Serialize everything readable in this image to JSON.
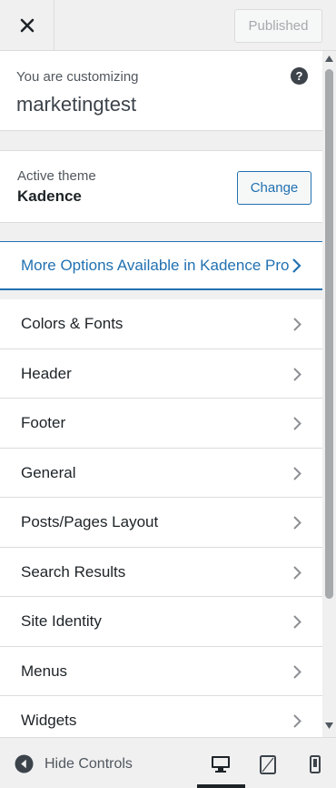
{
  "topbar": {
    "close_icon": "close-icon",
    "published_label": "Published"
  },
  "info": {
    "label": "You are customizing",
    "site_name": "marketingtest",
    "help_glyph": "?"
  },
  "theme": {
    "label": "Active theme",
    "name": "Kadence",
    "change_label": "Change"
  },
  "pro": {
    "label": "More Options Available in Kadence Pro",
    "accent": "#2271b1"
  },
  "menu": {
    "items": [
      {
        "label": "Colors & Fonts"
      },
      {
        "label": "Header"
      },
      {
        "label": "Footer"
      },
      {
        "label": "General"
      },
      {
        "label": "Posts/Pages Layout"
      },
      {
        "label": "Search Results"
      },
      {
        "label": "Site Identity"
      },
      {
        "label": "Menus"
      },
      {
        "label": "Widgets"
      }
    ]
  },
  "footer": {
    "hide_label": "Hide Controls",
    "devices": [
      "desktop-icon",
      "tablet-icon",
      "mobile-icon"
    ],
    "active_device": "desktop"
  }
}
